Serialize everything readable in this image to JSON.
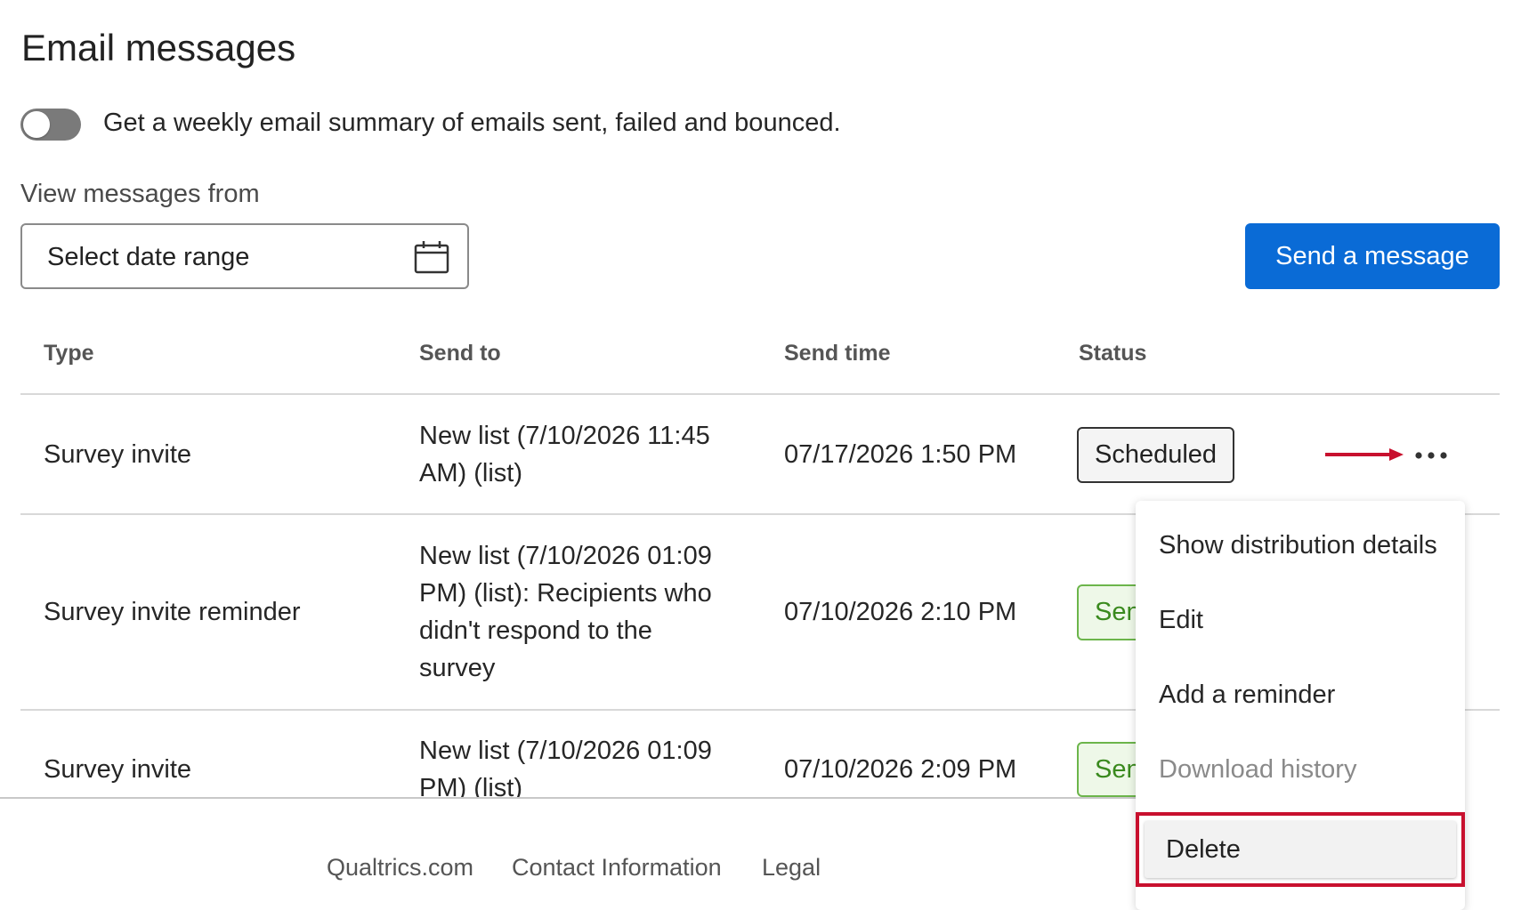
{
  "page": {
    "title": "Email messages"
  },
  "summary_toggle": {
    "label": "Get a weekly email summary of emails sent, failed and bounced.",
    "on": false
  },
  "filter": {
    "label": "View messages from",
    "placeholder": "Select date range",
    "icon": "calendar-icon"
  },
  "actions": {
    "send_message": "Send a message"
  },
  "table": {
    "headers": [
      "Type",
      "Send to",
      "Send time",
      "Status"
    ],
    "rows": [
      {
        "type": "Survey invite",
        "send_to_lines": [
          "New list (7/10/2026 11:45",
          "AM) (list)"
        ],
        "send_time": "07/17/2026 1:50 PM",
        "status": "Scheduled"
      },
      {
        "type": "Survey invite reminder",
        "send_to_lines": [
          "New list (7/10/2026 01:09",
          "PM) (list): Recipients who",
          "didn't respond to the",
          "survey"
        ],
        "send_time": "07/10/2026 2:10 PM",
        "status": "Sent"
      },
      {
        "type": "Survey invite",
        "send_to_lines": [
          "New list (7/10/2026 01:09",
          "PM) (list)"
        ],
        "send_time": "07/10/2026 2:09 PM",
        "status": "Sent"
      }
    ]
  },
  "row_menu": {
    "items": [
      "Show distribution details",
      "Edit",
      "Add a reminder",
      "Download history",
      "Delete"
    ],
    "disabled": [
      "Download history"
    ],
    "highlighted": "Delete"
  },
  "footer": {
    "links": [
      "Qualtrics.com",
      "Contact Information",
      "Legal"
    ]
  },
  "colors": {
    "primary": "#0a6bd6",
    "highlight": "#c8102e",
    "sent": "#3a8a1e"
  }
}
